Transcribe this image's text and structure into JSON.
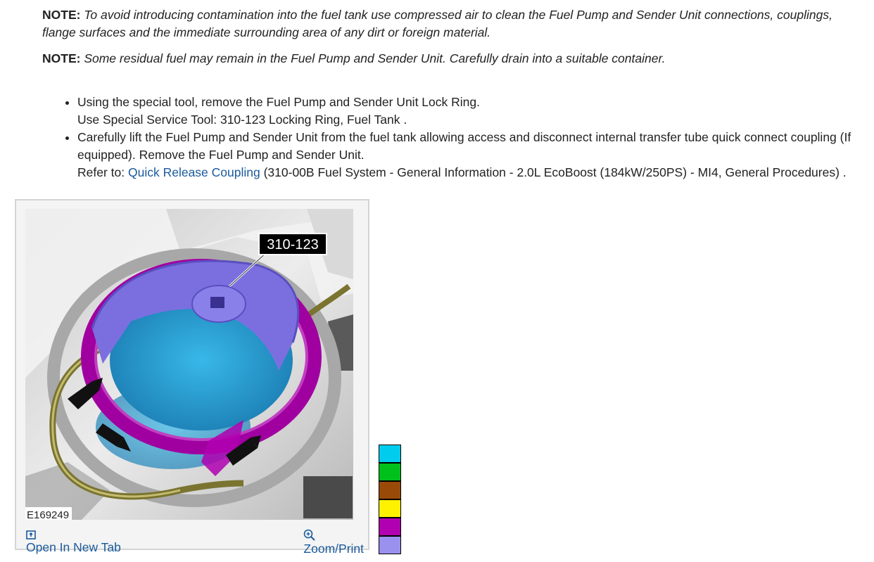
{
  "notes": [
    {
      "label": "NOTE:",
      "text": "To avoid introducing contamination into the fuel tank use compressed air to clean the Fuel Pump and Sender Unit connections, couplings, flange surfaces and the immediate surrounding area of any dirt or foreign material."
    },
    {
      "label": "NOTE:",
      "text": "Some residual fuel may remain in the Fuel Pump and Sender Unit. Carefully drain into a suitable container."
    }
  ],
  "steps": [
    {
      "line1": "Using the special tool, remove the Fuel Pump and Sender Unit Lock Ring.",
      "line2": "Use Special Service Tool: 310-123 Locking Ring, Fuel Tank ."
    },
    {
      "line1": "Carefully lift the Fuel Pump and Sender Unit from the fuel tank allowing access and disconnect internal transfer tube quick connect coupling (If equipped). Remove the Fuel Pump and Sender Unit.",
      "refer_prefix": "Refer to: ",
      "link_text": "Quick Release Coupling",
      "refer_suffix": " (310-00B Fuel System - General Information - 2.0L EcoBoost (184kW/250PS) - MI4, General Procedures) ."
    }
  ],
  "figure": {
    "callout": "310-123",
    "image_id": "E169249",
    "open_tab_label": "Open In New Tab",
    "zoom_label": "Zoom/Print",
    "icons": {
      "open_tab": "open-new-tab-icon",
      "zoom": "zoom-icon"
    }
  },
  "legend": {
    "colors": [
      "#00ccee",
      "#00c01c",
      "#9a4a08",
      "#fff200",
      "#b000b0",
      "#9a90ee"
    ]
  }
}
